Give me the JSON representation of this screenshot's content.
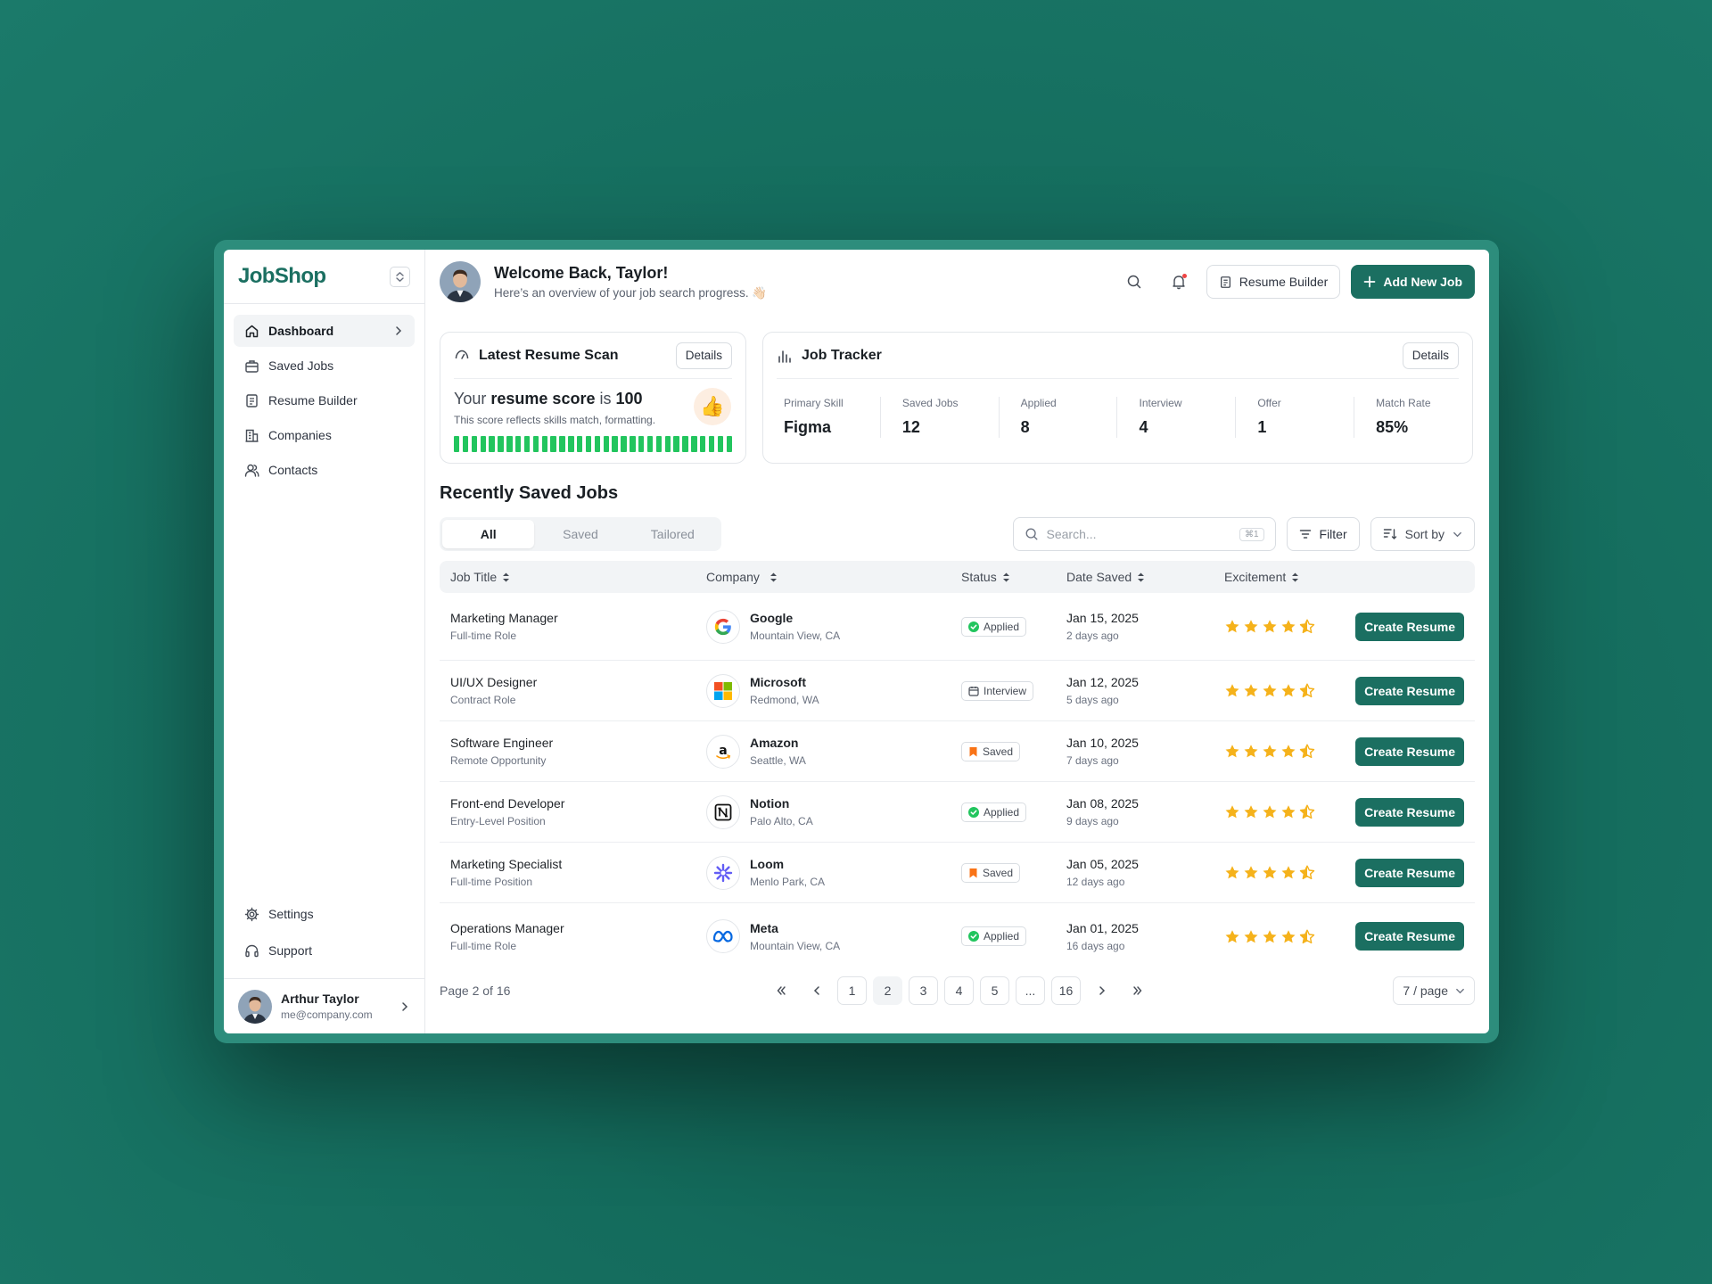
{
  "brand": {
    "name": "JobShop"
  },
  "sidebar": {
    "items": [
      {
        "label": "Dashboard",
        "icon": "home-icon",
        "active": true
      },
      {
        "label": "Saved Jobs",
        "icon": "briefcase-icon"
      },
      {
        "label": "Resume Builder",
        "icon": "document-icon"
      },
      {
        "label": "Companies",
        "icon": "building-icon"
      },
      {
        "label": "Contacts",
        "icon": "users-icon"
      }
    ],
    "bottom": [
      {
        "label": "Settings",
        "icon": "gear-icon"
      },
      {
        "label": "Support",
        "icon": "headset-icon"
      }
    ],
    "user": {
      "name": "Arthur Taylor",
      "email": "me@company.com"
    }
  },
  "header": {
    "title": "Welcome Back, Taylor!",
    "subtitle": "Here’s an overview of your job search progress. 👋🏻",
    "resume_builder_label": "Resume Builder",
    "add_job_label": "Add New Job"
  },
  "resume_scan": {
    "title": "Latest Resume Scan",
    "details_label": "Details",
    "score_prefix": "Your",
    "score_bold": "resume score",
    "score_mid": "is",
    "score_value": "100",
    "description": "This score reflects skills match, formatting.",
    "progress": 1.0
  },
  "job_tracker": {
    "title": "Job Tracker",
    "details_label": "Details",
    "stats": [
      {
        "label": "Primary Skill",
        "value": "Figma"
      },
      {
        "label": "Saved Jobs",
        "value": "12"
      },
      {
        "label": "Applied",
        "value": "8"
      },
      {
        "label": "Interview",
        "value": "4"
      },
      {
        "label": "Offer",
        "value": "1"
      },
      {
        "label": "Match Rate",
        "value": "85%"
      }
    ]
  },
  "jobs_section": {
    "title": "Recently Saved Jobs",
    "tabs": [
      {
        "label": "All",
        "active": true
      },
      {
        "label": "Saved"
      },
      {
        "label": "Tailored"
      }
    ],
    "search_placeholder": "Search...",
    "search_shortcut": "⌘1",
    "filter_label": "Filter",
    "sort_label": "Sort by",
    "columns": [
      "Job Title",
      "Company",
      "Status",
      "Date Saved",
      "Excitement"
    ],
    "action_label": "Create Resume",
    "rows": [
      {
        "title": "Marketing Manager",
        "type": "Full-time Role",
        "company": "Google",
        "location": "Mountain View, CA",
        "logo": "google-logo-icon",
        "status": "Applied",
        "date": "Jan 15, 2025",
        "ago": "2 days ago",
        "rating": 4.5
      },
      {
        "title": "UI/UX Designer",
        "type": "Contract Role",
        "company": "Microsoft",
        "location": "Redmond, WA",
        "logo": "microsoft-logo-icon",
        "status": "Interview",
        "date": "Jan 12, 2025",
        "ago": "5 days ago",
        "rating": 4.5
      },
      {
        "title": "Software Engineer",
        "type": "Remote Opportunity",
        "company": "Amazon",
        "location": "Seattle, WA",
        "logo": "amazon-logo-icon",
        "status": "Saved",
        "date": "Jan 10, 2025",
        "ago": "7 days ago",
        "rating": 4.5
      },
      {
        "title": "Front-end Developer",
        "type": "Entry-Level Position",
        "company": "Notion",
        "location": "Palo Alto, CA",
        "logo": "notion-logo-icon",
        "status": "Applied",
        "date": "Jan 08, 2025",
        "ago": "9 days ago",
        "rating": 4.5
      },
      {
        "title": "Marketing Specialist",
        "type": "Full-time Position",
        "company": "Loom",
        "location": "Menlo Park, CA",
        "logo": "loom-logo-icon",
        "status": "Saved",
        "date": "Jan 05, 2025",
        "ago": "12 days ago",
        "rating": 4.5
      },
      {
        "title": "Operations Manager",
        "type": "Full-time Role",
        "company": "Meta",
        "location": "Mountain View, CA",
        "logo": "meta-logo-icon",
        "status": "Applied",
        "date": "Jan 01, 2025",
        "ago": "16 days ago",
        "rating": 4.5
      }
    ]
  },
  "pagination": {
    "info": "Page 2 of 16",
    "pages": [
      "1",
      "2",
      "3",
      "4",
      "5",
      "...",
      "16"
    ],
    "current": "2",
    "per_page": "7 / page"
  },
  "colors": {
    "brand": "#1b6f61",
    "background": "#1b7a6a",
    "progress": "#22c55e",
    "star": "#f5b21b"
  }
}
